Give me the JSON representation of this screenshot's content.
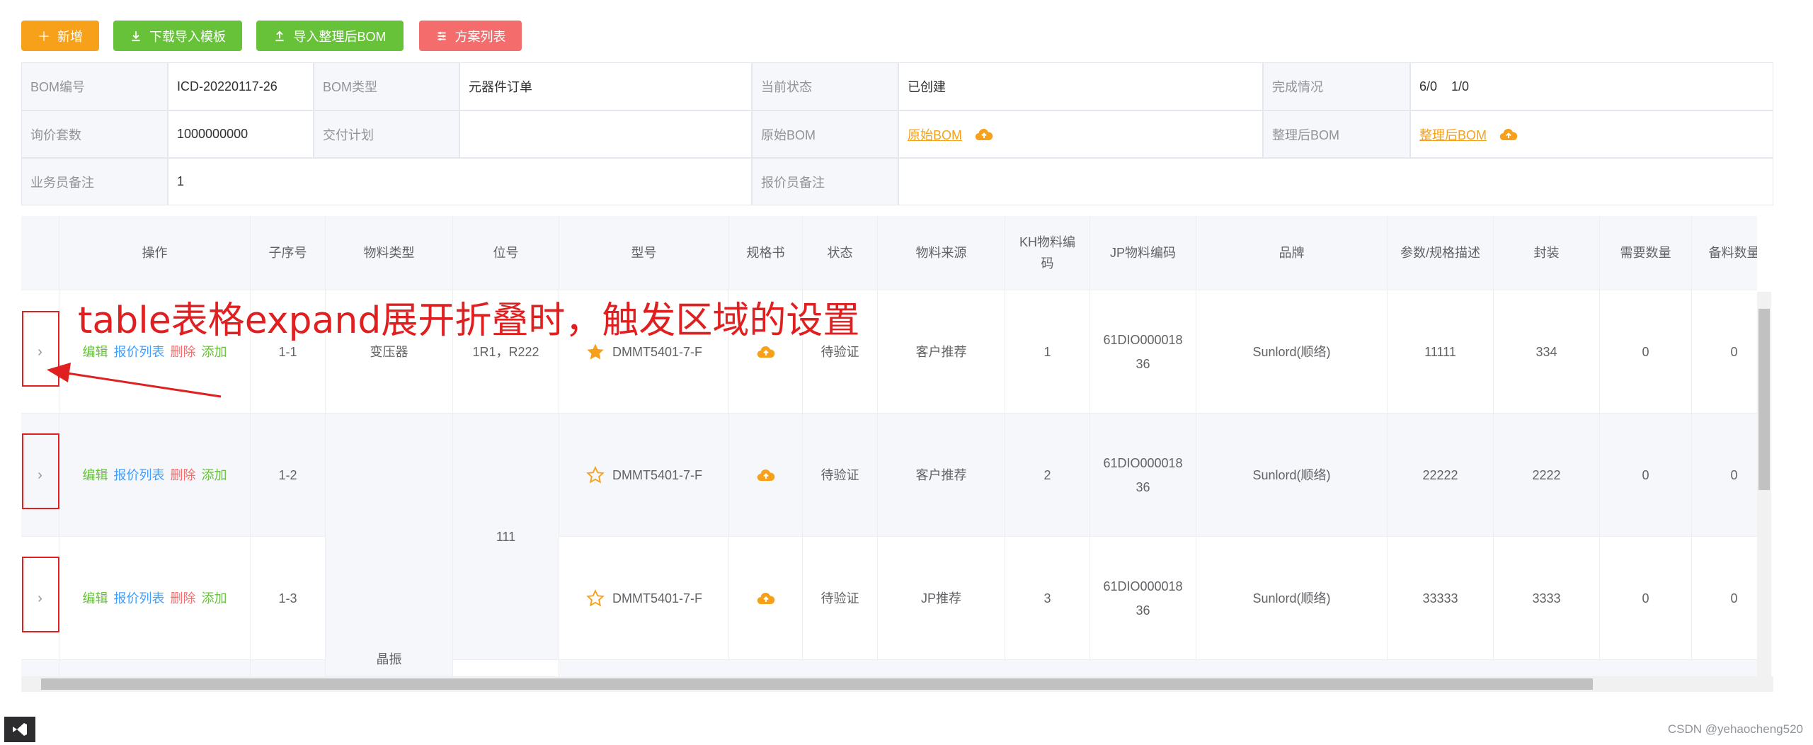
{
  "toolbar": {
    "add": "新增",
    "download_template": "下载导入模板",
    "import_bom": "导入整理后BOM",
    "plan_list": "方案列表"
  },
  "info": {
    "bom_no_label": "BOM编号",
    "bom_no": "ICD-20220117-26",
    "bom_type_label": "BOM类型",
    "bom_type": "元器件订单",
    "status_label": "当前状态",
    "status": "已创建",
    "completion_label": "完成情况",
    "completion": "6/0    1/0",
    "sets_label": "询价套数",
    "sets": "1000000000",
    "delivery_label": "交付计划",
    "delivery": "",
    "orig_bom_label": "原始BOM",
    "orig_bom": "原始BOM",
    "sorted_bom_label": "整理后BOM",
    "sorted_bom": "整理后BOM",
    "sales_note_label": "业务员备注",
    "sales_note": "1",
    "quoter_note_label": "报价员备注",
    "quoter_note": ""
  },
  "table": {
    "columns": [
      "操作",
      "子序号",
      "物料类型",
      "位号",
      "型号",
      "规格书",
      "状态",
      "物料来源",
      "KH物料编码",
      "JP物料编码",
      "品牌",
      "参数/规格描述",
      "封装",
      "需要数量",
      "备料数量"
    ],
    "ops": {
      "edit": "编辑",
      "quote_list": "报价列表",
      "delete": "删除",
      "add": "添加"
    },
    "merged": {
      "material_type_lower": "晶振",
      "position_merged": "111"
    },
    "rows": [
      {
        "sub_no": "1-1",
        "material_type": "变压器",
        "position": "1R1，R222",
        "model": "DMMT5401-7-F",
        "status": "待验证",
        "source": "客户推荐",
        "kh_code": "1",
        "jp_code": "61DIO00001836",
        "brand": "Sunlord(顺络)",
        "params": "11111",
        "package": "334",
        "need_qty": "0",
        "stock_qty": "0"
      },
      {
        "sub_no": "1-2",
        "model": "DMMT5401-7-F",
        "status": "待验证",
        "source": "客户推荐",
        "kh_code": "2",
        "jp_code": "61DIO00001836",
        "brand": "Sunlord(顺络)",
        "params": "22222",
        "package": "2222",
        "need_qty": "0",
        "stock_qty": "0"
      },
      {
        "sub_no": "1-3",
        "model": "DMMT5401-7-F",
        "status": "待验证",
        "source": "JP推荐",
        "kh_code": "3",
        "jp_code": "61DIO00001836",
        "brand": "Sunlord(顺络)",
        "params": "33333",
        "package": "3333",
        "need_qty": "0",
        "stock_qty": "0"
      }
    ]
  },
  "annotation": "table表格expand展开折叠时，触发区域的设置",
  "watermark": "CSDN @yehaocheng520",
  "icons": {
    "add": "plus-icon",
    "download": "download-icon",
    "upload": "upload-icon",
    "list": "list-icon",
    "cloud": "cloud-upload-icon",
    "star_filled": "star-filled-icon",
    "star_outline": "star-outline-icon",
    "expand": "chevron-right-icon"
  },
  "colors": {
    "orange": "#f7a019",
    "green": "#67c23a",
    "red": "#f56c6c",
    "blue": "#409eff",
    "annotation": "#e02020"
  }
}
